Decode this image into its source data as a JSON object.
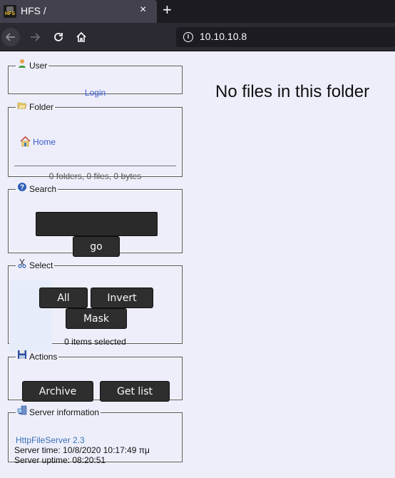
{
  "browser": {
    "tab_title": "HFS /",
    "favicon_text": "HFS",
    "close_tab": "×",
    "new_tab": "+",
    "url": "10.10.10.8"
  },
  "panels": {
    "user": {
      "legend": "User",
      "login": "Login"
    },
    "folder": {
      "legend": "Folder",
      "home": "Home",
      "stats": "0 folders, 0 files, 0 bytes"
    },
    "search": {
      "legend": "Search",
      "input_value": "",
      "go": "go"
    },
    "select": {
      "legend": "Select",
      "all": "All",
      "invert": "Invert",
      "mask": "Mask",
      "count": "0 items selected"
    },
    "actions": {
      "legend": "Actions",
      "archive": "Archive",
      "get_list": "Get list"
    },
    "server": {
      "legend": "Server information",
      "link": "HttpFileServer 2.3",
      "time": "Server time: 10/8/2020 10:17:49 πμ",
      "uptime": "Server uptime: 08:20:51"
    }
  },
  "main": {
    "message": "No files in this folder"
  },
  "icons": {
    "user": "user-icon",
    "folder": "open-folder-icon",
    "home": "home-folder-icon",
    "search": "help-question-icon",
    "select": "scissors-icon",
    "actions": "floppy-disk-icon",
    "server": "server-computer-icon"
  },
  "colors": {
    "background": "#edeefa",
    "link": "#3a5bd0",
    "button": "#2e2e2e",
    "browser_chrome": "#2b2a33"
  }
}
